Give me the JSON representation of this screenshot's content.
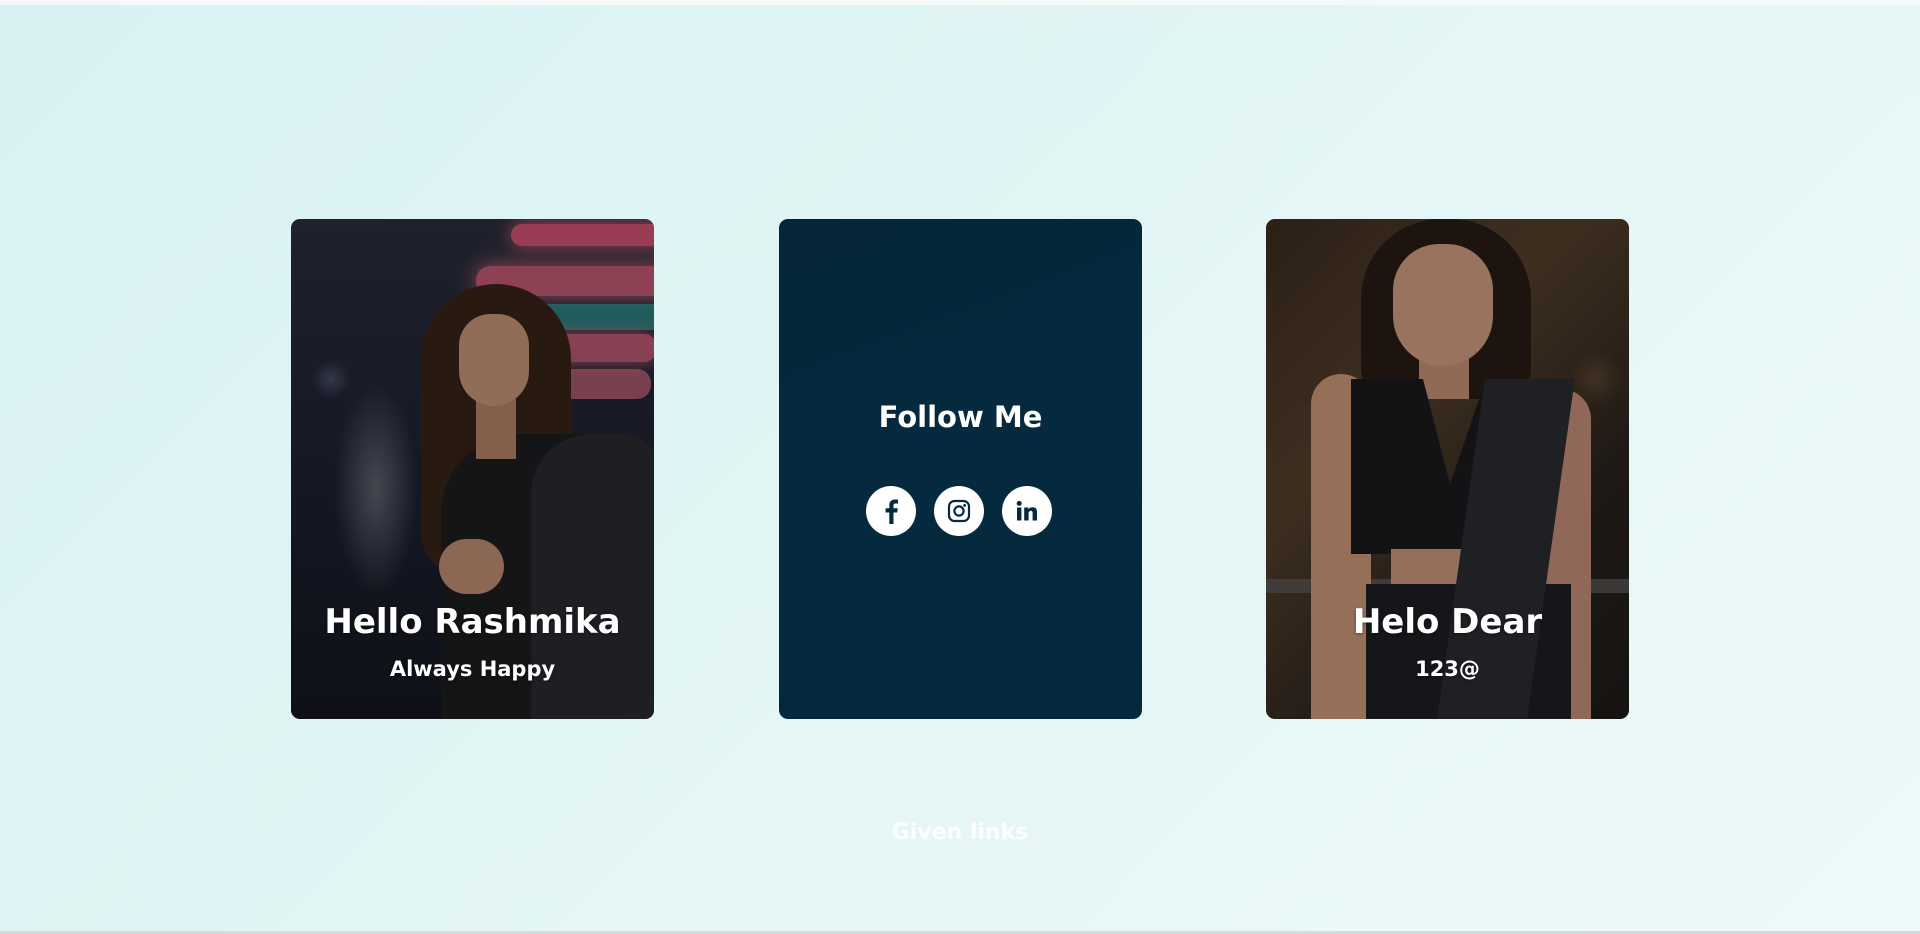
{
  "cards": [
    {
      "title": "Hello Rashmika",
      "subtitle": "Always Happy"
    },
    {
      "title": "Follow Me",
      "social": [
        {
          "icon": "facebook-icon"
        },
        {
          "icon": "instagram-icon"
        },
        {
          "icon": "linkedin-icon"
        }
      ]
    },
    {
      "title": "Helo Dear",
      "subtitle": "123@"
    }
  ],
  "footer": {
    "link_label": "Given links"
  },
  "colors": {
    "background": "#e0f5f5",
    "card_dark": "#052a3f",
    "icon_color": "#052a3f",
    "text_white": "#ffffff"
  }
}
